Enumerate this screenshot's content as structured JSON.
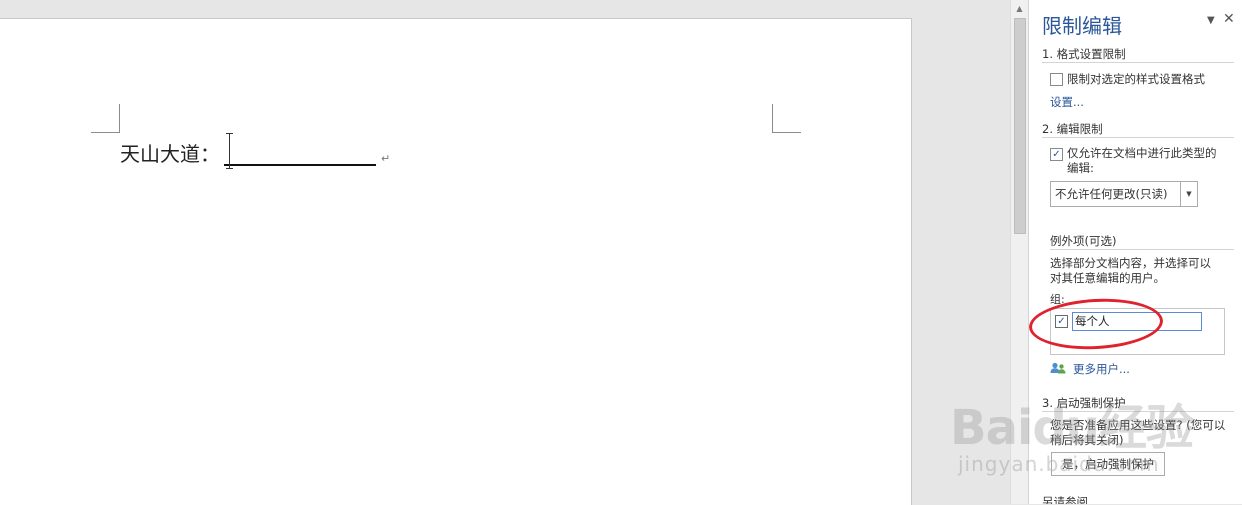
{
  "document": {
    "line_label": "天山大道：",
    "paragraph_mark": "↵"
  },
  "pane": {
    "title": "限制编辑",
    "menu_icon": "chevron-down-icon",
    "close_icon": "close-icon",
    "section1": {
      "title": "1. 格式设置限制",
      "checkbox_label": "限制对选定的样式设置格式",
      "settings_link": "设置..."
    },
    "section2": {
      "title": "2. 编辑限制",
      "checkbox_label_line1": "仅允许在文档中进行此类型的",
      "checkbox_label_line2": "编辑:",
      "select_value": "不允许任何更改(只读)",
      "exceptions_title": "例外项(可选)",
      "exceptions_desc_line1": "选择部分文档内容，并选择可以",
      "exceptions_desc_line2": "对其任意编辑的用户。",
      "groups_label": "组:",
      "group_item": "每个人",
      "more_users_link": "更多用户..."
    },
    "section3": {
      "title": "3. 启动强制保护",
      "desc_line1": "您是否准备应用这些设置? (您可以",
      "desc_line2": "稍后将其关闭)",
      "start_button": "是，启动强制保护"
    },
    "bottom_peek": "另请参阅"
  },
  "colors": {
    "accent": "#2b579a",
    "highlight_oval": "#e0222c"
  },
  "watermark": {
    "brand": "Baidu经验",
    "sub": "jingyan.baidu.com"
  }
}
